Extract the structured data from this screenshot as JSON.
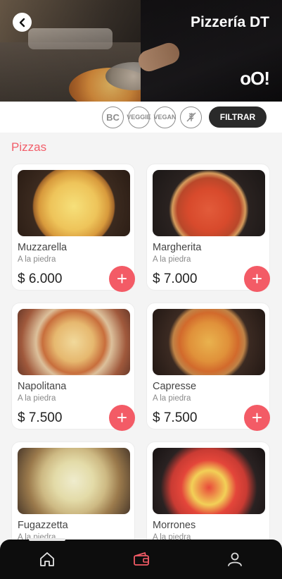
{
  "header": {
    "title": "Pizzería DT",
    "brand_mark": "oO!",
    "back_icon": "chevron-left-icon"
  },
  "filters": {
    "diet_icons": [
      "BC",
      "VEGGIE",
      "VEGAN",
      "sin gluten"
    ],
    "button_label": "FILTRAR"
  },
  "section": {
    "title": "Pizzas"
  },
  "products": [
    {
      "name": "Muzzarella",
      "subtitle": "A la piedra",
      "price": "$ 6.000"
    },
    {
      "name": "Margherita",
      "subtitle": "A la piedra",
      "price": "$ 7.000"
    },
    {
      "name": "Napolitana",
      "subtitle": "A la piedra",
      "price": "$ 7.500"
    },
    {
      "name": "Capresse",
      "subtitle": "A la piedra",
      "price": "$ 7.500"
    },
    {
      "name": "Fugazzetta",
      "subtitle": "A la piedra",
      "price": ""
    },
    {
      "name": "Morrones",
      "subtitle": "A la piedra",
      "price": ""
    }
  ],
  "add_label": "+",
  "bottom_nav": {
    "items": [
      "home-icon",
      "wallet-icon",
      "user-icon"
    ],
    "active_index": 0
  },
  "colors": {
    "accent": "#f35b66",
    "section_title": "#f25e6a",
    "nav_bg": "#0d0d0d",
    "filter_btn": "#2a2a2a"
  }
}
